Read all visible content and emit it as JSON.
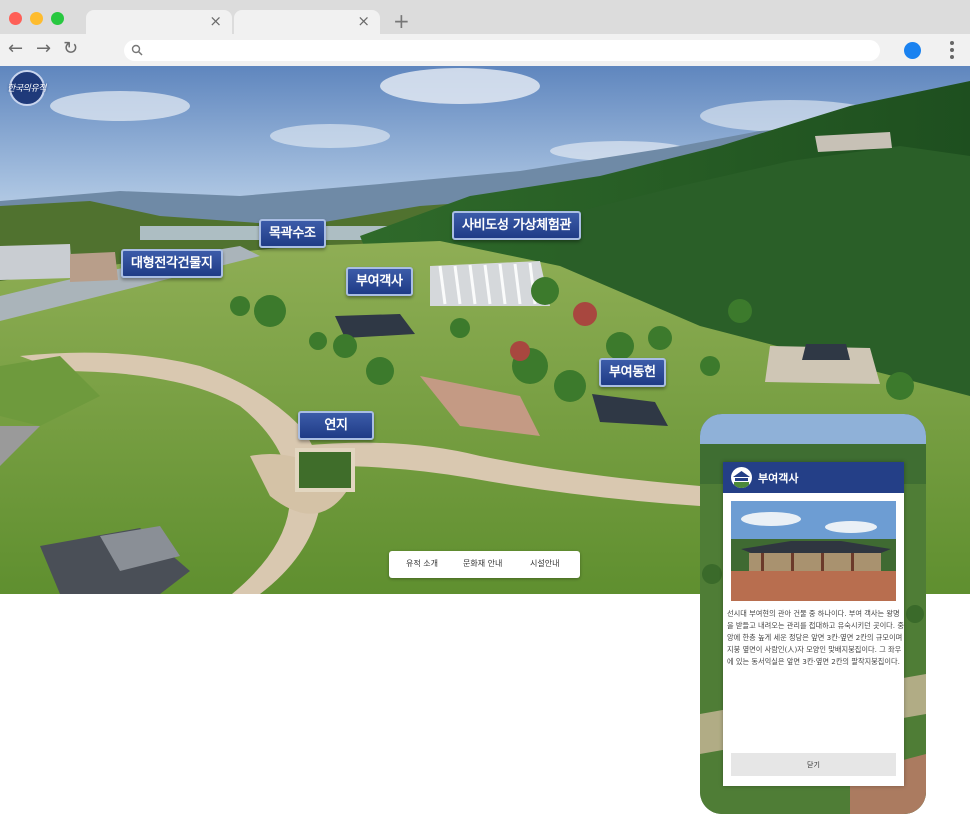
{
  "browser": {
    "tabs": [
      {
        "title": "",
        "close": "×"
      },
      {
        "title": "",
        "close": "×"
      }
    ],
    "new_tab": "+",
    "address": {
      "value": "",
      "placeholder": ""
    }
  },
  "colors": {
    "hotspot": "#2b4a9b",
    "popup_header": "#243f87",
    "profile": "#1a82f0"
  },
  "site": {
    "logo_text": "한국의유적"
  },
  "hotspots": {
    "daehyeong": "대형전각건물지",
    "mokgwak": "목곽수조",
    "sabi": "사비도성 가상체험관",
    "buyeo_gaeksa": "부여객사",
    "buyeo_donghyeon": "부여동헌",
    "yeonji": "연지"
  },
  "bottom_menu": {
    "intro": "유적 소개",
    "heritage": "문화재 안내",
    "facility": "시설안내"
  },
  "popup": {
    "title": "부여객사",
    "description": "선시대 부여현의 관아 건물 중 하나이다. 부여 객사는 왕명을 받들고 내려오는 관리를 접대하고 유숙시키던 곳이다. 중앙에 한층 높게 세운 정당은 앞면 3칸·옆면 2칸의 규모이며 지붕 옆면이 사람인(人)자 모양인 맞배지붕집이다. 그 좌우에 있는 동서익실은 앞면 3칸·옆면 2칸의 팔작지붕집이다.",
    "close_label": "닫기"
  }
}
